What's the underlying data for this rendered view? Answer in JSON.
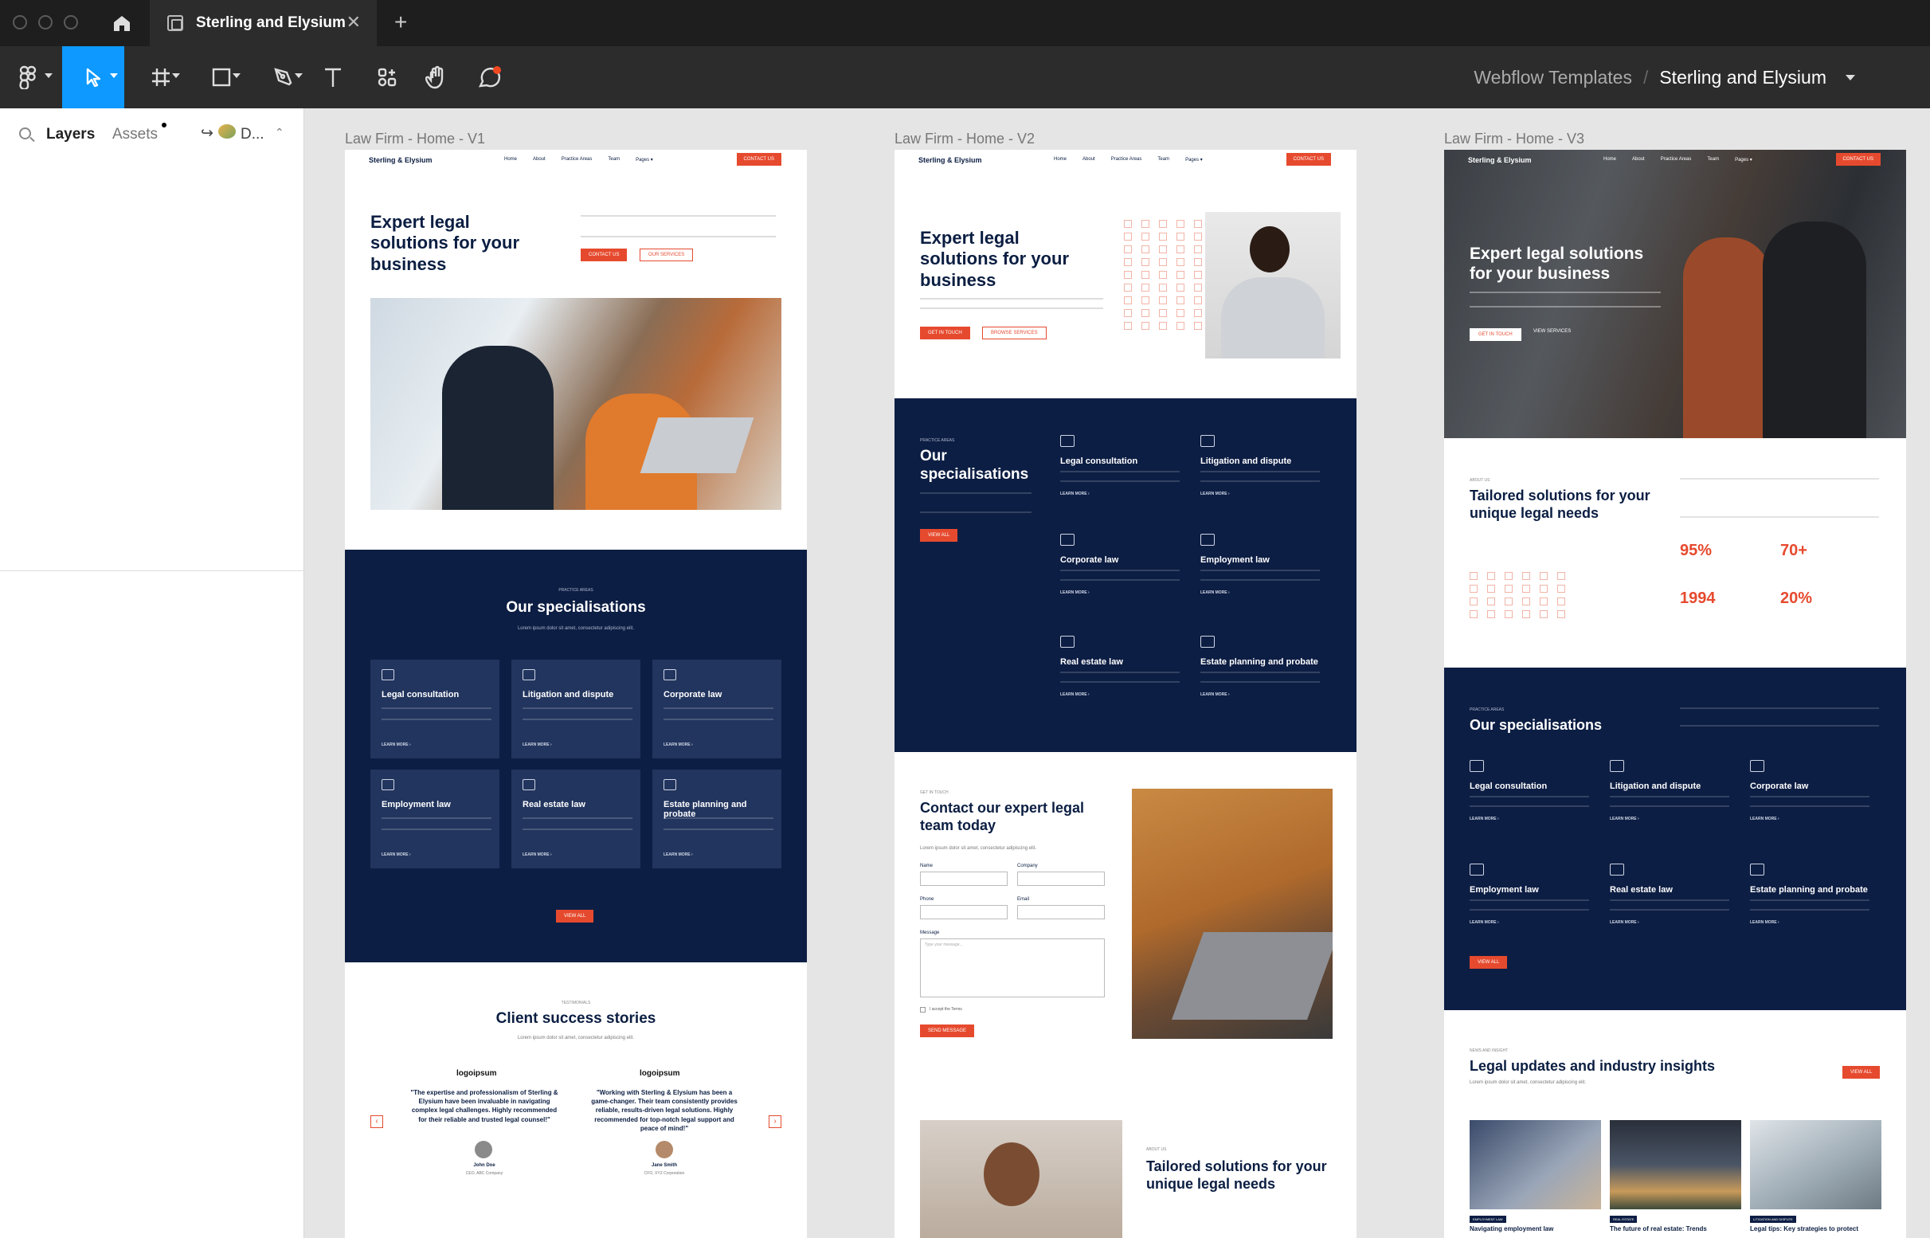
{
  "app": {
    "tab_title": "Sterling and Elysium",
    "new_tab": "+",
    "close": "✕"
  },
  "breadcrumb": {
    "team": "Webflow Templates",
    "separator": "/",
    "file": "Sterling and Elysium"
  },
  "sidebar": {
    "layers_tab": "Layers",
    "assets_tab": "Assets",
    "page": "D..."
  },
  "frames": {
    "v1": {
      "label": "Law Firm - Home - V1",
      "logo": "Sterling & Elysium",
      "nav": [
        "Home",
        "About",
        "Practice Areas",
        "Team",
        "Pages ▾"
      ],
      "cta": "CONTACT US",
      "hero_title": "Expert legal solutions for your business",
      "hero_btn1": "CONTACT US",
      "hero_btn2": "OUR SERVICES",
      "spec_eyebrow": "PRACTICE AREAS",
      "spec_title": "Our specialisations",
      "spec_sub": "Lorem ipsum dolor sit amet, consectetur adipiscing elit.",
      "cards": [
        {
          "title": "Legal consultation",
          "link": "LEARN MORE ›"
        },
        {
          "title": "Litigation and dispute",
          "link": "LEARN MORE ›"
        },
        {
          "title": "Corporate law",
          "link": "LEARN MORE ›"
        },
        {
          "title": "Employment law",
          "link": "LEARN MORE ›"
        },
        {
          "title": "Real estate law",
          "link": "LEARN MORE ›"
        },
        {
          "title": "Estate planning and probate",
          "link": "LEARN MORE ›"
        }
      ],
      "view_all": "VIEW ALL",
      "test_eyebrow": "TESTIMONIALS",
      "test_title": "Client success stories",
      "test_sub": "Lorem ipsum dolor sit amet, consectetur adipiscing elit.",
      "logo1": "logoipsum",
      "logo2": "logoipsum",
      "quote1": "\"The expertise and professionalism of Sterling & Elysium have been invaluable in navigating complex legal challenges. Highly recommended for their reliable and trusted legal counsel!\"",
      "quote2": "\"Working with Sterling & Elysium has been a game-changer. Their team consistently provides reliable, results-driven legal solutions. Highly recommended for top-notch legal support and peace of mind!\"",
      "person1": "John Doe",
      "role1": "CEO, ABC Company",
      "person2": "Jane Smith",
      "role2": "CFO, XYZ Corporation"
    },
    "v2": {
      "label": "Law Firm - Home - V2",
      "logo": "Sterling & Elysium",
      "nav": [
        "Home",
        "About",
        "Practice Areas",
        "Team",
        "Pages ▾"
      ],
      "cta": "CONTACT US",
      "hero_title": "Expert legal solutions for your business",
      "hero_btn1": "GET IN TOUCH",
      "hero_btn2": "BROWSE SERVICES",
      "spec_eyebrow": "PRACTICE AREAS",
      "spec_title": "Our specialisations",
      "view_all": "VIEW ALL",
      "specs": [
        {
          "title": "Legal consultation",
          "link": "LEARN MORE ›"
        },
        {
          "title": "Litigation and dispute",
          "link": "LEARN MORE ›"
        },
        {
          "title": "Corporate law",
          "link": "LEARN MORE ›"
        },
        {
          "title": "Employment law",
          "link": "LEARN MORE ›"
        },
        {
          "title": "Real estate law",
          "link": "LEARN MORE ›"
        },
        {
          "title": "Estate planning and probate",
          "link": "LEARN MORE ›"
        }
      ],
      "contact_eyebrow": "GET IN TOUCH",
      "contact_title": "Contact our expert legal team today",
      "contact_sub": "Lorem ipsum dolor sit amet, consectetur adipiscing elit.",
      "f_name": "Name",
      "f_company": "Company",
      "f_phone": "Phone",
      "f_email": "Email",
      "f_message": "Message",
      "msg_placeholder": "Type your message...",
      "terms": "I accept the Terms",
      "send": "SEND MESSAGE",
      "about_eyebrow": "ABOUT US",
      "about_title": "Tailored solutions for your unique legal needs"
    },
    "v3": {
      "label": "Law Firm - Home - V3",
      "logo": "Sterling & Elysium",
      "nav": [
        "Home",
        "About",
        "Practice Areas",
        "Team",
        "Pages ▾"
      ],
      "cta": "CONTACT US",
      "hero_title": "Expert legal solutions for your business",
      "hero_btn1": "GET IN TOUCH",
      "hero_btn2": "VIEW SERVICES",
      "about_eyebrow": "ABOUT US",
      "about_title": "Tailored solutions for your unique legal needs",
      "stats": [
        {
          "value": "95%"
        },
        {
          "value": "70+"
        },
        {
          "value": "1994"
        },
        {
          "value": "20%"
        }
      ],
      "spec_eyebrow": "PRACTICE AREAS",
      "spec_title": "Our specialisations",
      "specs": [
        {
          "title": "Legal consultation",
          "link": "LEARN MORE ›"
        },
        {
          "title": "Litigation and dispute",
          "link": "LEARN MORE ›"
        },
        {
          "title": "Corporate law",
          "link": "LEARN MORE ›"
        },
        {
          "title": "Employment law",
          "link": "LEARN MORE ›"
        },
        {
          "title": "Real estate law",
          "link": "LEARN MORE ›"
        },
        {
          "title": "Estate planning and probate",
          "link": "LEARN MORE ›"
        }
      ],
      "view_all": "VIEW ALL",
      "news_eyebrow": "NEWS AND INSIGHT",
      "news_title": "Legal updates and industry insights",
      "news_sub": "Lorem ipsum dolor sit amet, consectetur adipiscing elit.",
      "news_view_all": "VIEW ALL",
      "posts": [
        {
          "tag": "EMPLOYMENT LAW",
          "title": "Navigating employment law"
        },
        {
          "tag": "REAL ESTATE",
          "title": "The future of real estate: Trends"
        },
        {
          "tag": "LITIGATION AND DISPUTE",
          "title": "Legal tips: Key strategies to protect"
        }
      ]
    }
  },
  "colors": {
    "accent": "#e64a2e",
    "navy": "#0d1e44",
    "figma_blue": "#0d99ff"
  }
}
